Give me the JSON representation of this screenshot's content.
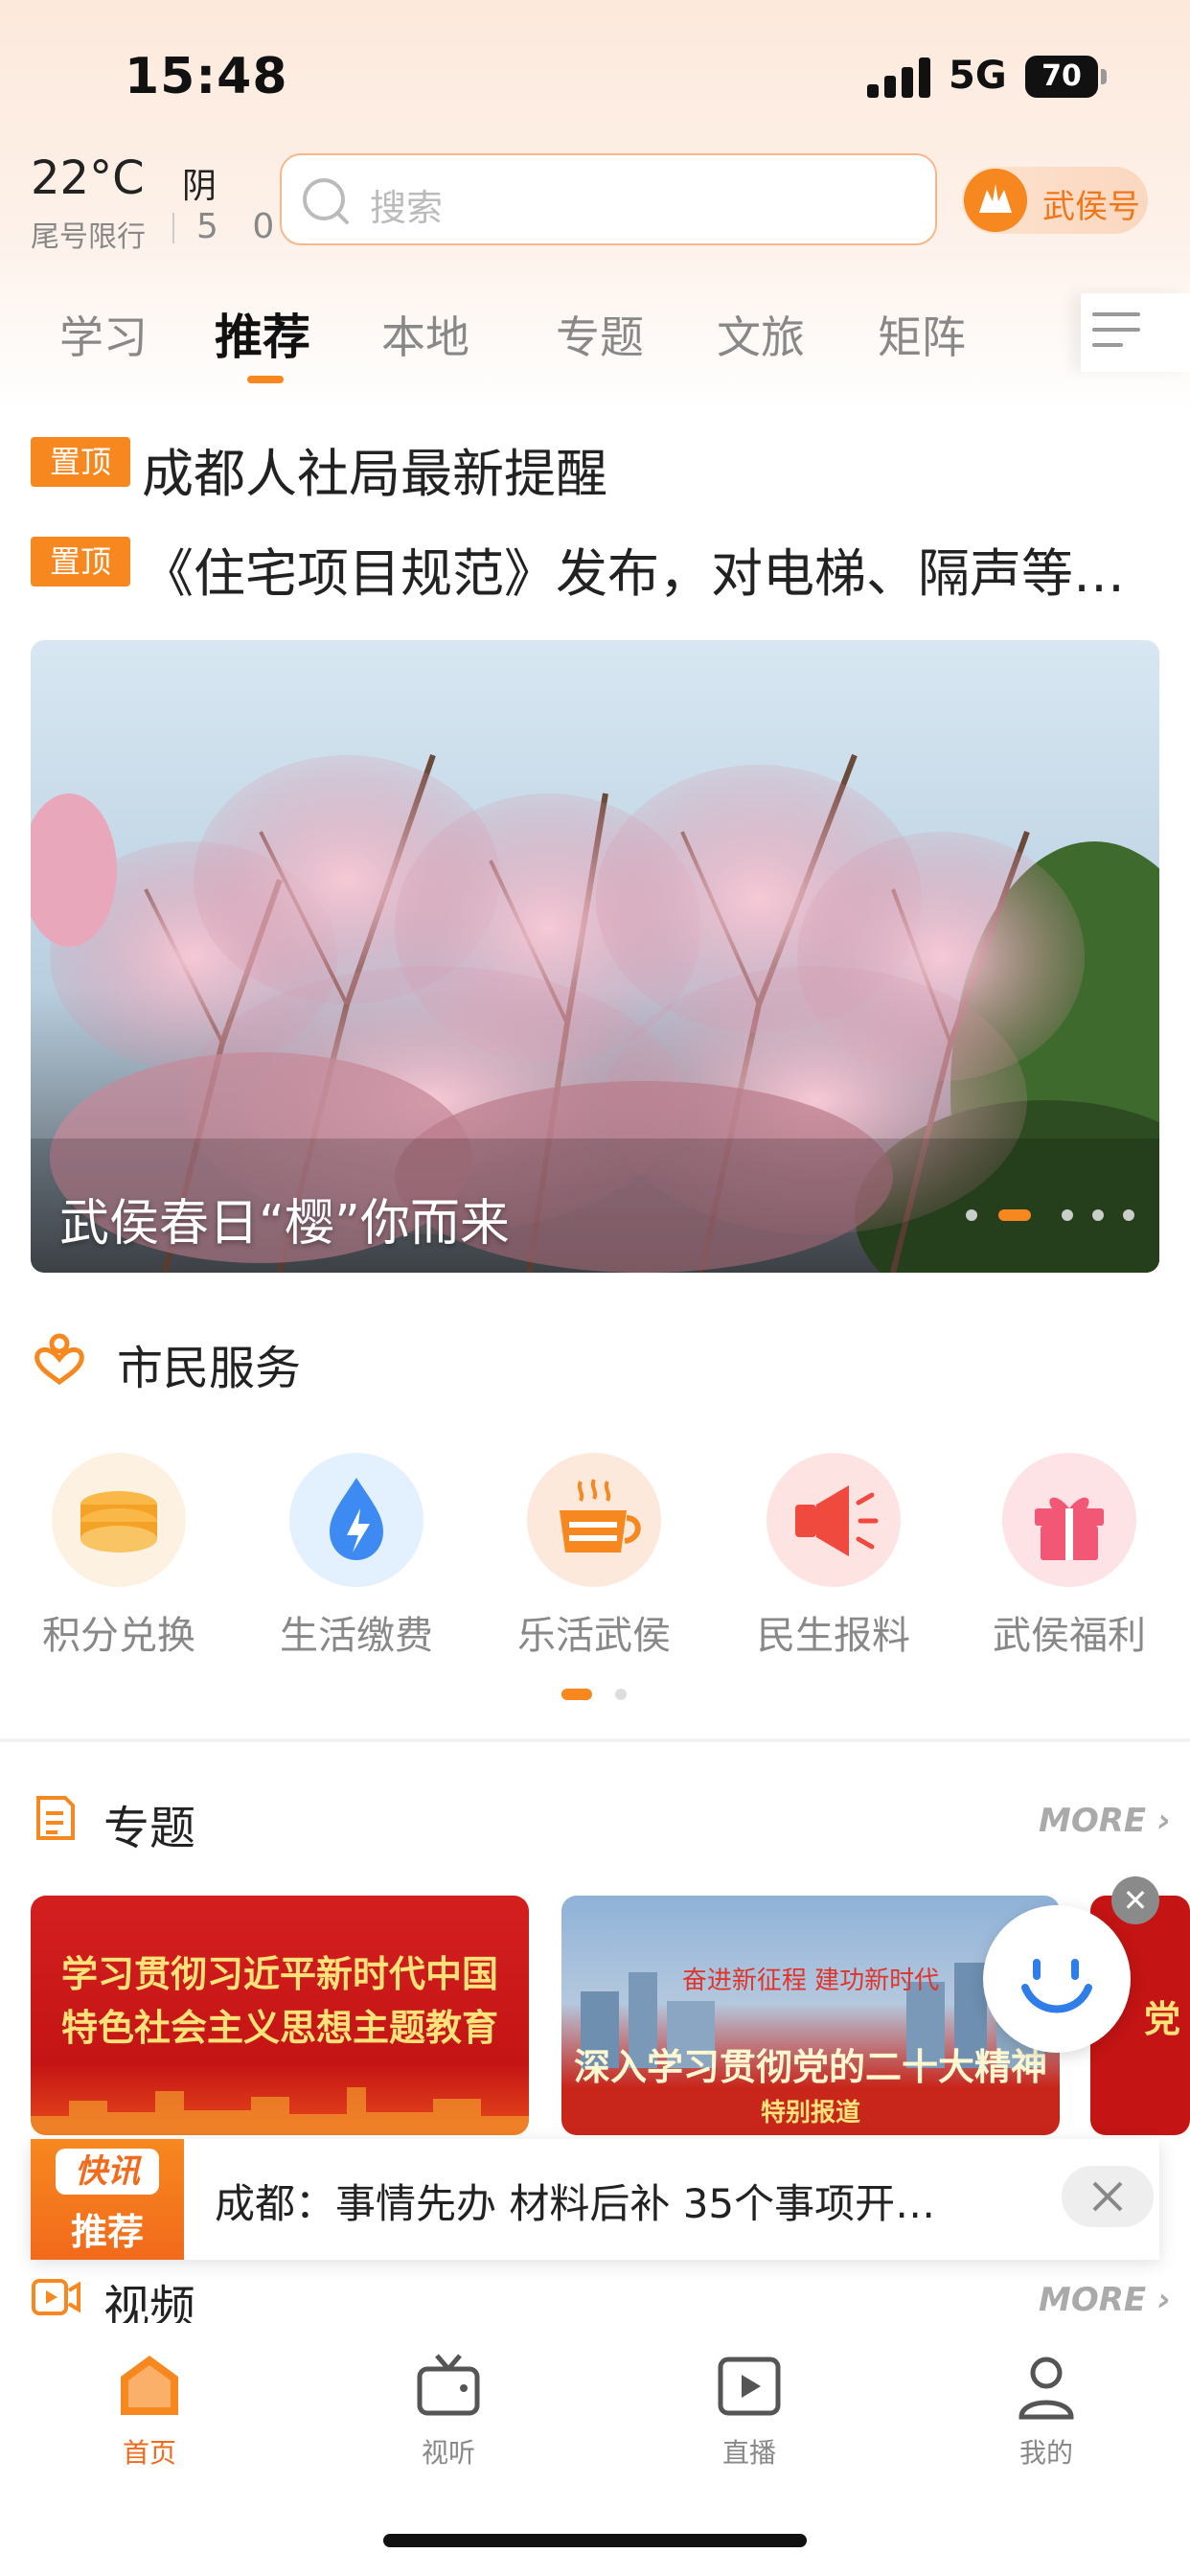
{
  "status_bar": {
    "time": "15:48",
    "network": "5G",
    "battery": "70"
  },
  "header": {
    "temperature": "22°C",
    "weather": "阴",
    "restriction_label": "尾号限行",
    "restriction_numbers": "5 0",
    "search_placeholder": "搜索",
    "account_label": "武侯号"
  },
  "tabs": [
    {
      "label": "学习",
      "active": false
    },
    {
      "label": "推荐",
      "active": true
    },
    {
      "label": "本地",
      "active": false
    },
    {
      "label": "专题",
      "active": false
    },
    {
      "label": "文旅",
      "active": false
    },
    {
      "label": "矩阵",
      "active": false
    }
  ],
  "pinned": [
    {
      "tag": "置顶",
      "title": "成都人社局最新提醒"
    },
    {
      "tag": "置顶",
      "title": "《住宅项目规范》发布，对电梯、隔声等…"
    }
  ],
  "banner": {
    "caption": "武侯春日“樱”你而来",
    "page_count": 5,
    "active_page": 2
  },
  "services": {
    "title": "市民服务",
    "items": [
      {
        "label": "积分兑换",
        "icon": "coins-icon"
      },
      {
        "label": "生活缴费",
        "icon": "water-drop-icon"
      },
      {
        "label": "乐活武侯",
        "icon": "tea-cup-icon"
      },
      {
        "label": "民生报料",
        "icon": "megaphone-icon"
      },
      {
        "label": "武侯福利",
        "icon": "gift-icon"
      }
    ]
  },
  "topics": {
    "title": "专题",
    "more": "MORE",
    "card1": "学习贯彻习近平新时代中国特色社会主义思想主题教育",
    "card2_line1": "奋进新征程 建功新时代",
    "card2_line2": "深入学习贯彻党的二十大精神",
    "card2_line3": "特别报道",
    "card3": "党"
  },
  "news_flash": {
    "badge_top": "快讯",
    "badge_bottom": "推荐",
    "text": "成都：事情先办 材料后补 35个事项开…"
  },
  "videos": {
    "title": "视频",
    "more": "MORE"
  },
  "tabbar": [
    {
      "label": "首页",
      "icon": "home-icon",
      "active": true
    },
    {
      "label": "视听",
      "icon": "tv-icon",
      "active": false
    },
    {
      "label": "直播",
      "icon": "play-icon",
      "active": false
    },
    {
      "label": "我的",
      "icon": "user-icon",
      "active": false
    }
  ],
  "colors": {
    "accent": "#f7881f",
    "accent_dark": "#f26a1b",
    "blue": "#3d8bf2"
  }
}
